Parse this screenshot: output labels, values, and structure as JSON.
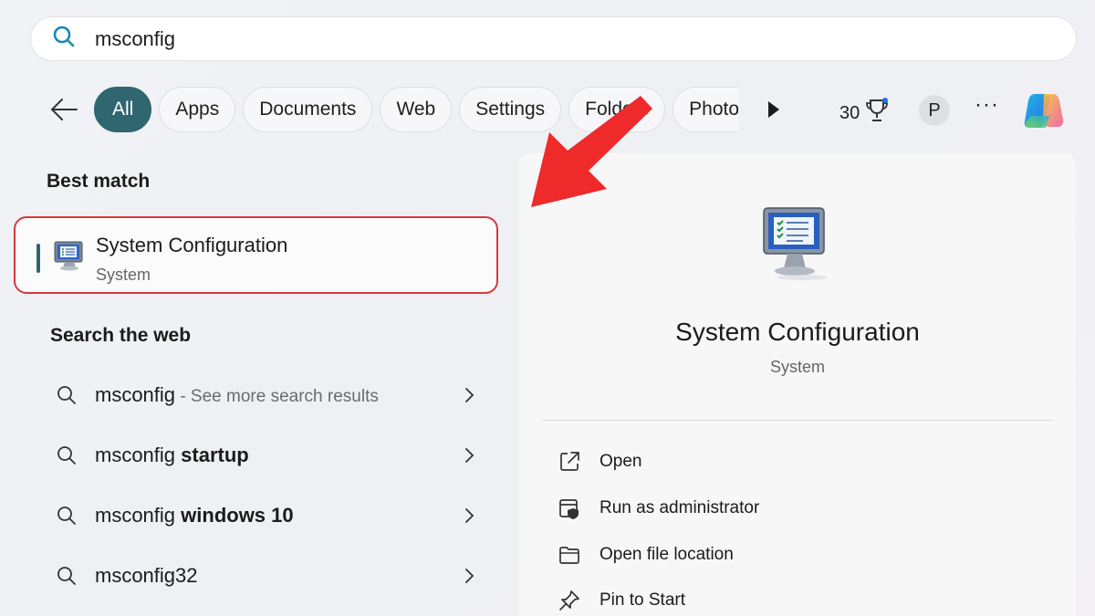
{
  "search": {
    "query": "msconfig"
  },
  "filters": {
    "chips": [
      "All",
      "Apps",
      "Documents",
      "Web",
      "Settings",
      "Folders",
      "Photos"
    ],
    "active": "All",
    "points": "30",
    "avatar_letter": "P",
    "more": "···"
  },
  "best_match": {
    "heading": "Best match",
    "name": "System Configuration",
    "type": "System"
  },
  "web": {
    "heading": "Search the web",
    "items": [
      {
        "prefix": "msconfig",
        "bold": "",
        "hint": " - See more search results"
      },
      {
        "prefix": "msconfig ",
        "bold": "startup",
        "hint": ""
      },
      {
        "prefix": "msconfig ",
        "bold": "windows 10",
        "hint": ""
      },
      {
        "prefix": "msconfig32",
        "bold": "",
        "hint": ""
      }
    ]
  },
  "preview": {
    "title": "System Configuration",
    "subtitle": "System",
    "actions": [
      {
        "label": "Open",
        "icon": "open-external-icon"
      },
      {
        "label": "Run as administrator",
        "icon": "shield-admin-icon"
      },
      {
        "label": "Open file location",
        "icon": "folder-icon"
      },
      {
        "label": "Pin to Start",
        "icon": "pin-icon"
      }
    ]
  },
  "colors": {
    "accent": "#2f6670",
    "highlight": "#d6393b",
    "arrow": "#ee2a2a"
  }
}
